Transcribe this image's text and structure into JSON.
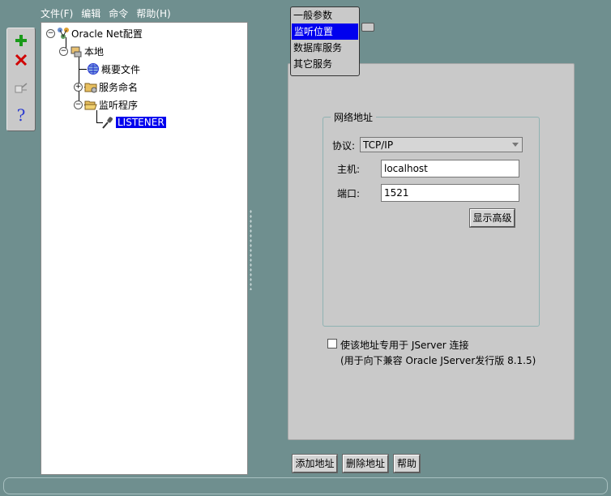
{
  "menu": [
    "文件(F)",
    "编辑",
    "命令",
    "帮助(H)"
  ],
  "toolbar": {
    "add_icon": "plus-icon",
    "delete_icon": "x-icon",
    "test_icon": "test-connection-icon",
    "help_icon": "question-icon"
  },
  "tree": {
    "root": "Oracle Net配置",
    "local": "本地",
    "profile": "概要文件",
    "naming": "服务命名",
    "listeners": "监听程序",
    "listener": "LISTENER"
  },
  "page_menu": {
    "items": [
      "一般参数",
      "监听位置",
      "数据库服务",
      "其它服务"
    ],
    "selected": "监听位置"
  },
  "address": {
    "legend": "网络地址",
    "protocol_label": "协议:",
    "protocol_value": "TCP/IP",
    "host_label": "主机:",
    "host_value": "localhost",
    "port_label": "端口:",
    "port_value": "1521",
    "advanced_button": "显示高级"
  },
  "jserver": {
    "checkbox_label": "使该地址专用于 JServer 连接",
    "note": "(用于向下兼容 Oracle JServer发行版 8.1.5)",
    "checked": false
  },
  "buttons": {
    "add_address": "添加地址",
    "delete_address": "删除地址",
    "help": "帮助"
  },
  "colors": {
    "background": "#6f8f8f",
    "selection": "#0000ee",
    "panel": "#c9c9c9"
  }
}
